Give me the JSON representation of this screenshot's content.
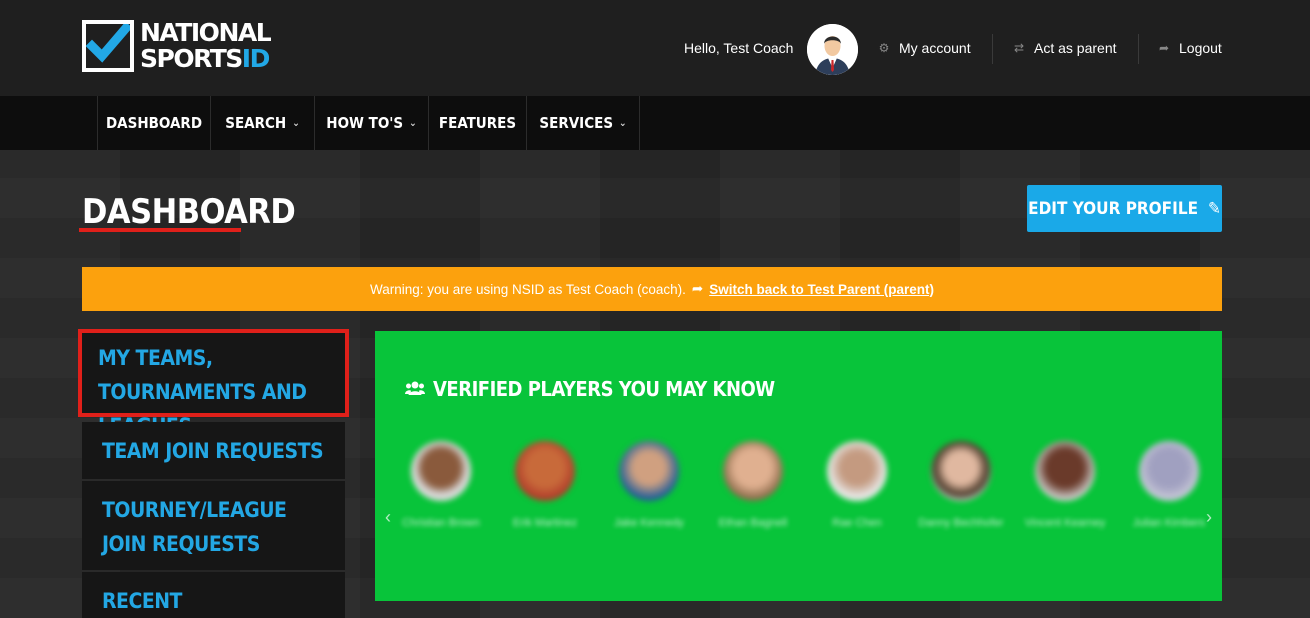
{
  "header": {
    "logo_line1": "NATIONAL",
    "logo_line2_a": "SPORTS",
    "logo_line2_b": "ID",
    "greeting": "Hello, Test Coach",
    "my_account": "My account",
    "act_as_parent": "Act as parent",
    "logout": "Logout"
  },
  "nav": {
    "items": [
      {
        "label": "DASHBOARD"
      },
      {
        "label": "SEARCH"
      },
      {
        "label": "HOW TO'S"
      },
      {
        "label": "FEATURES"
      },
      {
        "label": "SERVICES"
      }
    ]
  },
  "page": {
    "title": "DASHBOARD",
    "edit_profile": "EDIT YOUR PROFILE"
  },
  "warning": {
    "text": "Warning: you are using NSID as Test Coach (coach).",
    "switch_link": "Switch back to Test Parent (parent)"
  },
  "sidebar": {
    "items": [
      {
        "label": "MY TEAMS, TOURNAMENTS AND LEAGUES"
      },
      {
        "label": "TEAM JOIN REQUESTS"
      },
      {
        "label": "TOURNEY/LEAGUE JOIN REQUESTS"
      },
      {
        "label": "RECENT ANNOUNCEMENTS"
      }
    ]
  },
  "players_panel": {
    "title": "VERIFIED PLAYERS YOU MAY KNOW",
    "players": [
      {
        "name": "Christian Brown"
      },
      {
        "name": "Erik Martinez"
      },
      {
        "name": "Jake Kennedy"
      },
      {
        "name": "Ethan Bagnell"
      },
      {
        "name": "Rae Chen"
      },
      {
        "name": "Danny Bechhofer"
      },
      {
        "name": "Vincent Kearney"
      },
      {
        "name": "Julian Kimbers"
      }
    ]
  },
  "colors": {
    "accent_blue": "#1aa9e8",
    "warning": "#fca10d",
    "panel_green": "#08c43a",
    "highlight_red": "#e0201a"
  }
}
